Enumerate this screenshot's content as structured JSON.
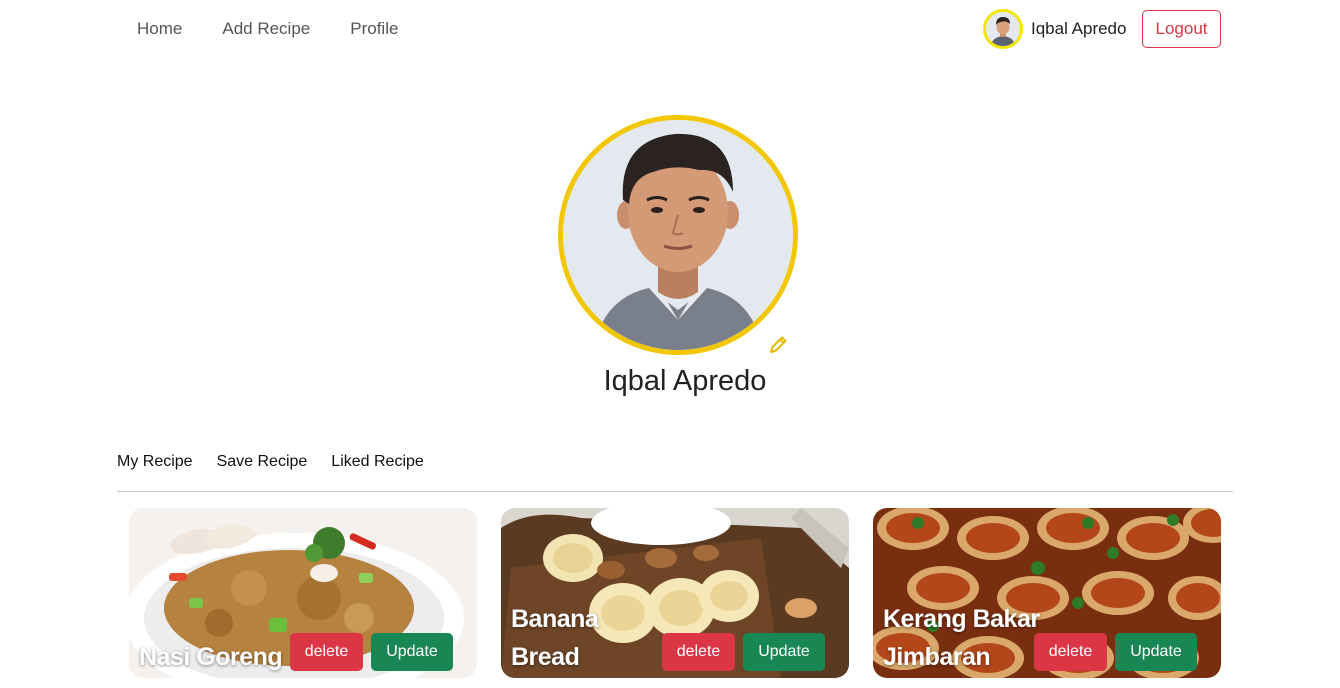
{
  "nav": {
    "links": [
      "Home",
      "Add Recipe",
      "Profile"
    ],
    "username": "Iqbal Apredo",
    "logout_label": "Logout"
  },
  "profile": {
    "name": "Iqbal Apredo",
    "avatar_icon": "person-photo",
    "edit_icon": "pencil-icon",
    "accent_color": "#f2c700"
  },
  "tabs": [
    "My Recipe",
    "Save Recipe",
    "Liked Recipe"
  ],
  "recipes": [
    {
      "title": "Nasi Goreng",
      "delete_label": "delete",
      "update_label": "Update"
    },
    {
      "title": "Banana Bread",
      "delete_label": "delete",
      "update_label": "Update"
    },
    {
      "title": "Kerang Bakar Jimbaran",
      "delete_label": "delete",
      "update_label": "Update"
    }
  ],
  "colors": {
    "danger": "#dc3545",
    "success": "#198754"
  }
}
